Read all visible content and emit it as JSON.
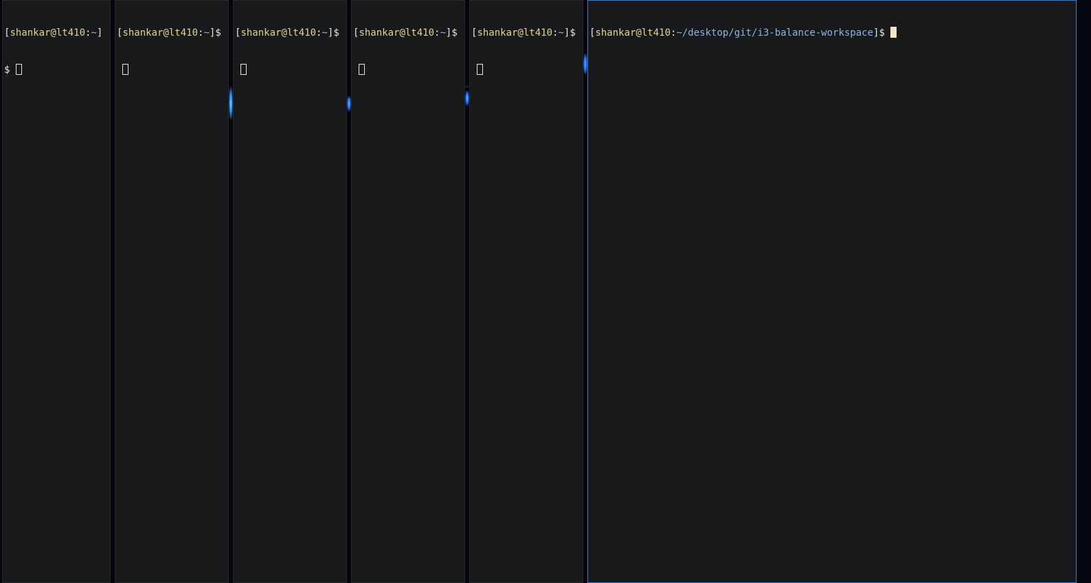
{
  "colors": {
    "background": "#18191b",
    "gap": "#05060d",
    "focused_border": "#3e79c4",
    "prompt_user": "#e9d391",
    "prompt_path": "#8ab4e8",
    "glow": "#1f8fff"
  },
  "terminals": [
    {
      "user": "shankar@lt410",
      "sep": ":",
      "path": "~",
      "open": "[",
      "close": "]",
      "dollar": "",
      "line2": "$ "
    },
    {
      "user": "shankar@lt410",
      "sep": ":",
      "path": "~",
      "open": "[",
      "close": "]",
      "dollar": "$"
    },
    {
      "user": "shankar@lt410",
      "sep": ":",
      "path": "~",
      "open": "[",
      "close": "]",
      "dollar": "$"
    },
    {
      "user": "shankar@lt410",
      "sep": ":",
      "path": "~",
      "open": "[",
      "close": "]",
      "dollar": "$"
    },
    {
      "user": "shankar@lt410",
      "sep": ":",
      "path": "~",
      "open": "[",
      "close": "]",
      "dollar": "$"
    },
    {
      "user": "shankar@lt410",
      "sep": ":",
      "path": "~/desktop/git/i3-balance-workspace",
      "open": "[",
      "close": "]",
      "dollar": "$ "
    }
  ]
}
